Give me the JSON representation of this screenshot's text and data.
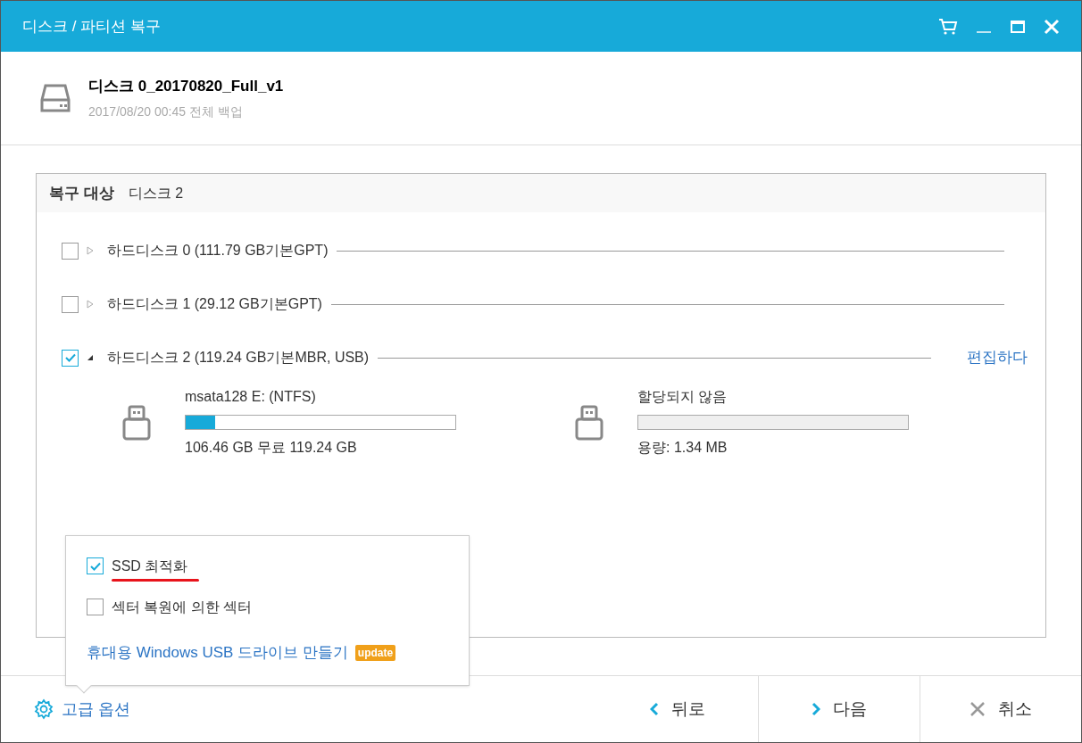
{
  "window": {
    "title": "디스크 / 파티션 복구"
  },
  "backup": {
    "name": "디스크 0_20170820_Full_v1",
    "subtitle": "2017/08/20 00:45 전체 백업"
  },
  "target": {
    "label": "복구 대상",
    "value": "디스크 2"
  },
  "disks": [
    {
      "label": "하드디스크 0 (111.79 GB기본GPT)",
      "checked": false,
      "expanded": false
    },
    {
      "label": "하드디스크 1 (29.12 GB기본GPT)",
      "checked": false,
      "expanded": false
    },
    {
      "label": "하드디스크 2 (119.24 GB기본MBR, USB)",
      "checked": true,
      "expanded": true,
      "edit_link": "편집하다",
      "partitions": [
        {
          "name": "msata128 E: (NTFS)",
          "kind": "used",
          "level": 0.11,
          "caption": "106.46 GB 무료 119.24 GB"
        },
        {
          "name": "할당되지 않음",
          "kind": "unallocated",
          "level": 0,
          "caption": "용량: 1.34 MB"
        }
      ]
    }
  ],
  "advanced_popup": {
    "options": [
      {
        "label": "SSD 최적화",
        "checked": true,
        "underlined": true
      },
      {
        "label": "섹터 복원에 의한 섹터",
        "checked": false,
        "underlined": false
      }
    ],
    "link": "휴대용 Windows USB 드라이브 만들기",
    "badge": "update"
  },
  "footer": {
    "advanced": "고급 옵션",
    "buttons": [
      {
        "kind": "back",
        "label": "뒤로"
      },
      {
        "kind": "next",
        "label": "다음"
      },
      {
        "kind": "cancel",
        "label": "취소"
      }
    ]
  }
}
